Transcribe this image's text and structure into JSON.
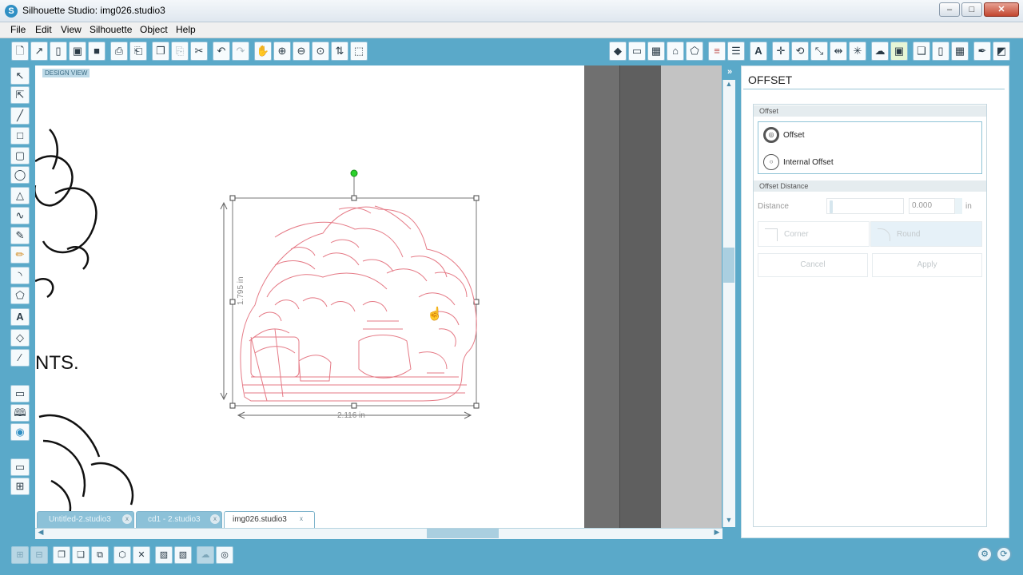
{
  "window": {
    "title": "Silhouette Studio: img026.studio3",
    "app_icon": "S",
    "minimize": "–",
    "maximize": "□",
    "close": "✕"
  },
  "menu": [
    "File",
    "Edit",
    "View",
    "Silhouette",
    "Object",
    "Help"
  ],
  "toolbar": {
    "left_icons": [
      "new-document-icon",
      "open-folder-icon",
      "library-icon",
      "save-icon",
      "save-to-library-icon",
      "print-icon",
      "print-cut-icon",
      "copy-icon",
      "paste-icon",
      "cut-icon",
      "undo-icon",
      "redo-icon",
      "pan-hand-icon",
      "zoom-in-icon",
      "zoom-out-icon",
      "zoom-selection-icon",
      "drag-zoom-icon",
      "fit-to-page-icon"
    ],
    "right_icons": [
      "fill-color-icon",
      "page-setup-icon",
      "grid-icon",
      "registration-marks-icon",
      "trace-icon",
      "line-color-icon",
      "line-style-icon",
      "text-style-icon",
      "transform-icon",
      "rotate-icon",
      "scale-icon",
      "align-icon",
      "replicate-icon",
      "modify-icon",
      "offset-icon",
      "trace-panel-icon",
      "send-to-silhouette-icon",
      "cut-settings-icon",
      "grid-view-icon",
      "knife-icon",
      "eraser-icon"
    ]
  },
  "canvas": {
    "design_view_label": "DESIGN VIEW",
    "height_dimension": "1.795 in",
    "width_dimension": "2.116 in",
    "handwritten_text": "NTS."
  },
  "tabs": [
    {
      "label": "Untitled-2.studio3",
      "active": false,
      "close": "x"
    },
    {
      "label": "cd1 - 2.studio3",
      "active": false,
      "close": "x"
    },
    {
      "label": "img026.studio3",
      "active": true,
      "close": "x"
    }
  ],
  "panel": {
    "title": "OFFSET",
    "offset_section": "Offset",
    "offset_option": "Offset",
    "internal_offset_option": "Internal Offset",
    "distance_section": "Offset Distance",
    "distance_label": "Distance",
    "distance_value": "0.000",
    "distance_unit": "in",
    "corner_label": "Corner",
    "round_label": "Round",
    "cancel_label": "Cancel",
    "apply_label": "Apply"
  },
  "colors": {
    "chrome": "#5aa9c9",
    "cut_line": "#e57a86",
    "rotate_handle": "#2bd12b"
  }
}
